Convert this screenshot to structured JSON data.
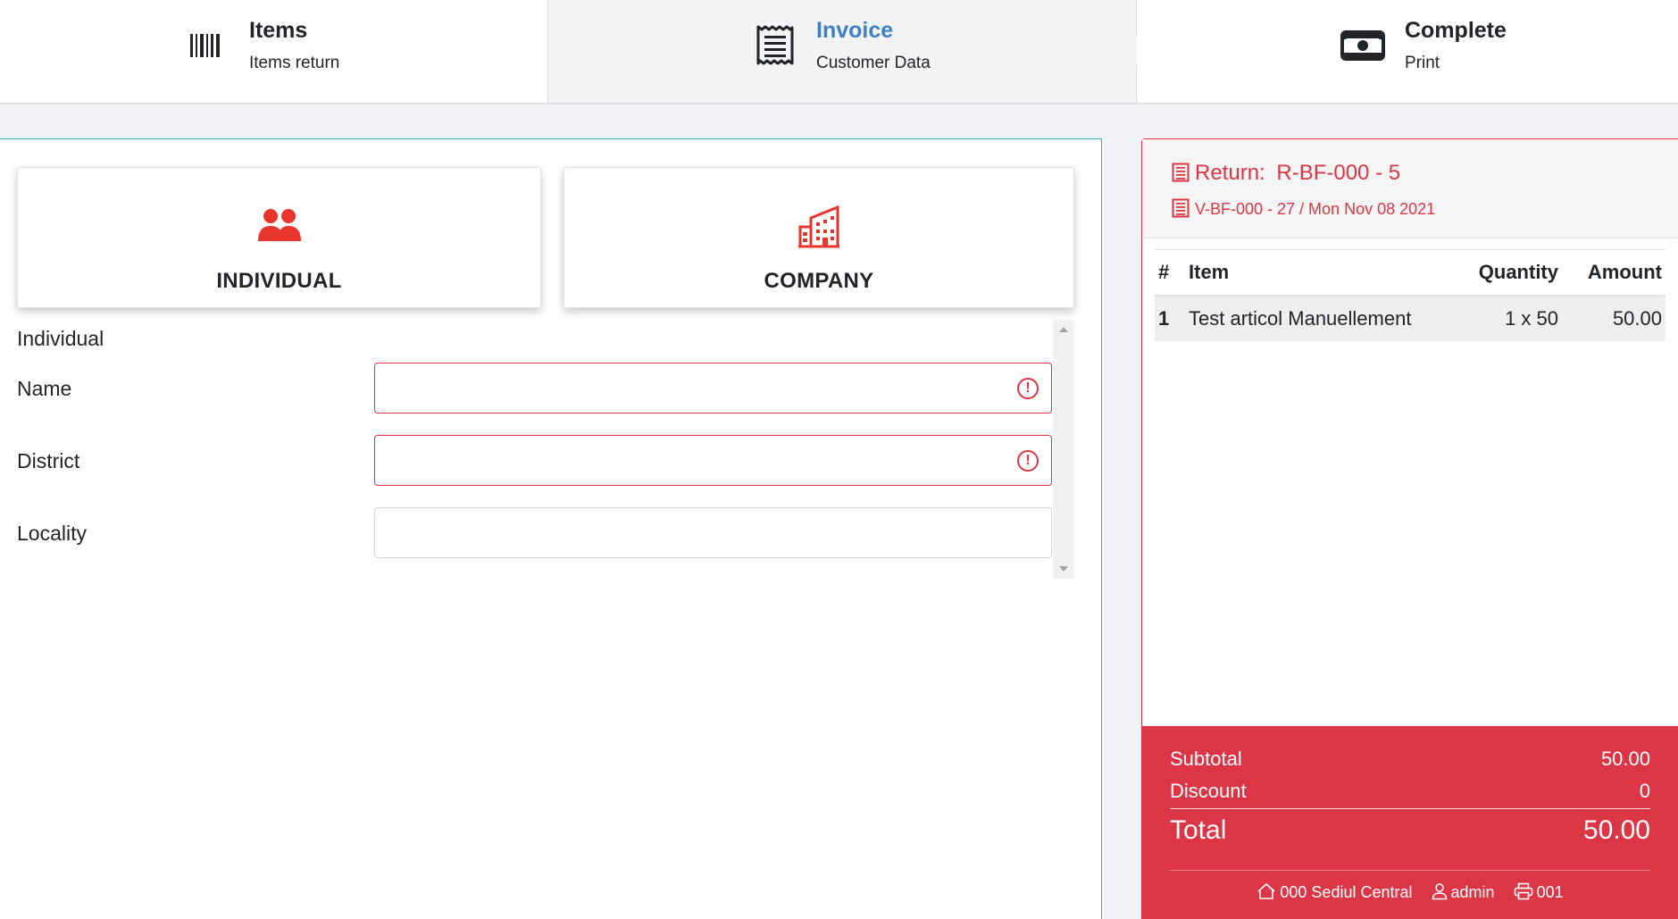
{
  "stepper": {
    "steps": [
      {
        "title": "Items",
        "subtitle": "Items return",
        "icon": "barcode-icon",
        "state": "done"
      },
      {
        "title": "Invoice",
        "subtitle": "Customer Data",
        "icon": "receipt-icon",
        "state": "active"
      },
      {
        "title": "Complete",
        "subtitle": "Print",
        "icon": "money-bill-icon",
        "state": "pending"
      }
    ]
  },
  "customer_type": {
    "options": [
      {
        "label": "INDIVIDUAL",
        "icon": "users-icon"
      },
      {
        "label": "COMPANY",
        "icon": "building-icon"
      }
    ],
    "accent_color": "#e8352c"
  },
  "form": {
    "section_title": "Individual",
    "fields": [
      {
        "label": "Name",
        "value": "",
        "invalid": true
      },
      {
        "label": "District",
        "value": "",
        "invalid": true
      },
      {
        "label": "Locality",
        "value": "",
        "invalid": false
      }
    ]
  },
  "receipt": {
    "return_label": "Return:",
    "return_number": "R-BF-000 - 5",
    "invoice_ref": "V-BF-000 - 27 / Mon Nov 08 2021",
    "columns": [
      "#",
      "Item",
      "Quantity",
      "Amount"
    ],
    "rows": [
      {
        "index": "1",
        "item": "Test articol Manuellement",
        "quantity": "1 x 50",
        "amount": "50.00"
      }
    ],
    "totals": {
      "subtotal_label": "Subtotal",
      "subtotal": "50.00",
      "discount_label": "Discount",
      "discount": "0",
      "total_label": "Total",
      "total": "50.00"
    },
    "footer": {
      "store": "000 Sediul Central",
      "user": "admin",
      "register": "001"
    },
    "accent_color": "#dc3545"
  }
}
